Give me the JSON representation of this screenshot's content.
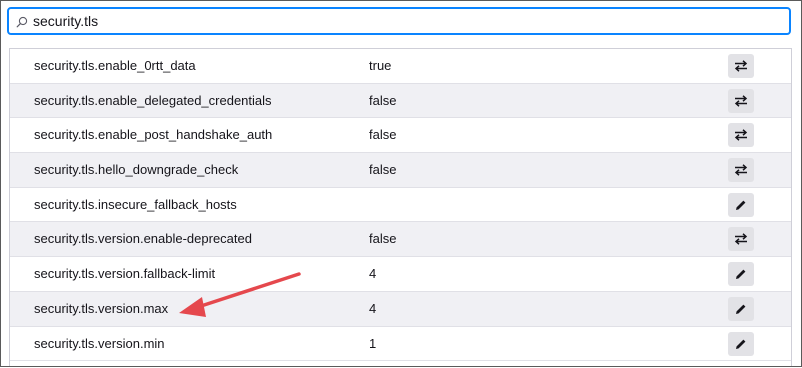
{
  "search": {
    "value": "security.tls",
    "icon": "search-icon"
  },
  "prefs": [
    {
      "name": "security.tls.enable_0rtt_data",
      "value": "true",
      "action": "toggle-icon"
    },
    {
      "name": "security.tls.enable_delegated_credentials",
      "value": "false",
      "action": "toggle-icon"
    },
    {
      "name": "security.tls.enable_post_handshake_auth",
      "value": "false",
      "action": "toggle-icon"
    },
    {
      "name": "security.tls.hello_downgrade_check",
      "value": "false",
      "action": "toggle-icon"
    },
    {
      "name": "security.tls.insecure_fallback_hosts",
      "value": "",
      "action": "edit-icon"
    },
    {
      "name": "security.tls.version.enable-deprecated",
      "value": "false",
      "action": "toggle-icon"
    },
    {
      "name": "security.tls.version.fallback-limit",
      "value": "4",
      "action": "edit-icon"
    },
    {
      "name": "security.tls.version.max",
      "value": "4",
      "action": "edit-icon"
    },
    {
      "name": "security.tls.version.min",
      "value": "1",
      "action": "edit-icon"
    }
  ],
  "colors": {
    "accent": "#0a84ff",
    "annotation_arrow": "#e5484d",
    "row_alt": "#f0f0f4",
    "button_bg": "#e2e2e6"
  }
}
